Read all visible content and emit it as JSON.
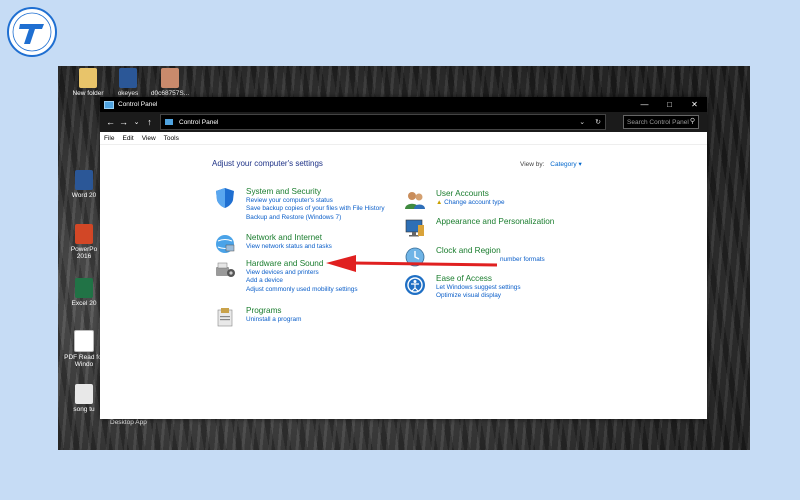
{
  "desktop": {
    "icons": [
      {
        "label": "New folder"
      },
      {
        "label": "okeyes"
      },
      {
        "label": "d0c68757S..."
      },
      {
        "label": "Word 20"
      },
      {
        "label": "PowerPo 2016"
      },
      {
        "label": "Excel 20"
      },
      {
        "label": "PDF Read for Windo"
      },
      {
        "label": "song tu"
      }
    ],
    "desktop_app_label": "Desktop App"
  },
  "window": {
    "title": "Control Panel",
    "address": "Control Panel",
    "search_placeholder": "Search Control Panel",
    "menu": [
      "File",
      "Edit",
      "View",
      "Tools"
    ]
  },
  "content": {
    "heading": "Adjust your computer's settings",
    "view_by_label": "View by:",
    "view_by_value": "Category",
    "left_categories": [
      {
        "title": "System and Security",
        "links": [
          "Review your computer's status",
          "Save backup copies of your files with File History",
          "Backup and Restore (Windows 7)"
        ]
      },
      {
        "title": "Network and Internet",
        "links": [
          "View network status and tasks"
        ]
      },
      {
        "title": "Hardware and Sound",
        "links": [
          "View devices and printers",
          "Add a device",
          "Adjust commonly used mobility settings"
        ]
      },
      {
        "title": "Programs",
        "links": [
          "Uninstall a program"
        ]
      }
    ],
    "right_categories": [
      {
        "title": "User Accounts",
        "links": [
          "Change account type"
        ]
      },
      {
        "title": "Appearance and Personalization",
        "links": []
      },
      {
        "title": "Clock and Region",
        "links": [
          "number formats"
        ]
      },
      {
        "title": "Ease of Access",
        "links": [
          "Let Windows suggest settings",
          "Optimize visual display"
        ]
      }
    ]
  },
  "colors": {
    "page_bg": "#c6dcf5",
    "category_title": "#1a7d2e",
    "link": "#0a5ec9",
    "heading": "#1e3287",
    "arrow": "#e02020"
  }
}
